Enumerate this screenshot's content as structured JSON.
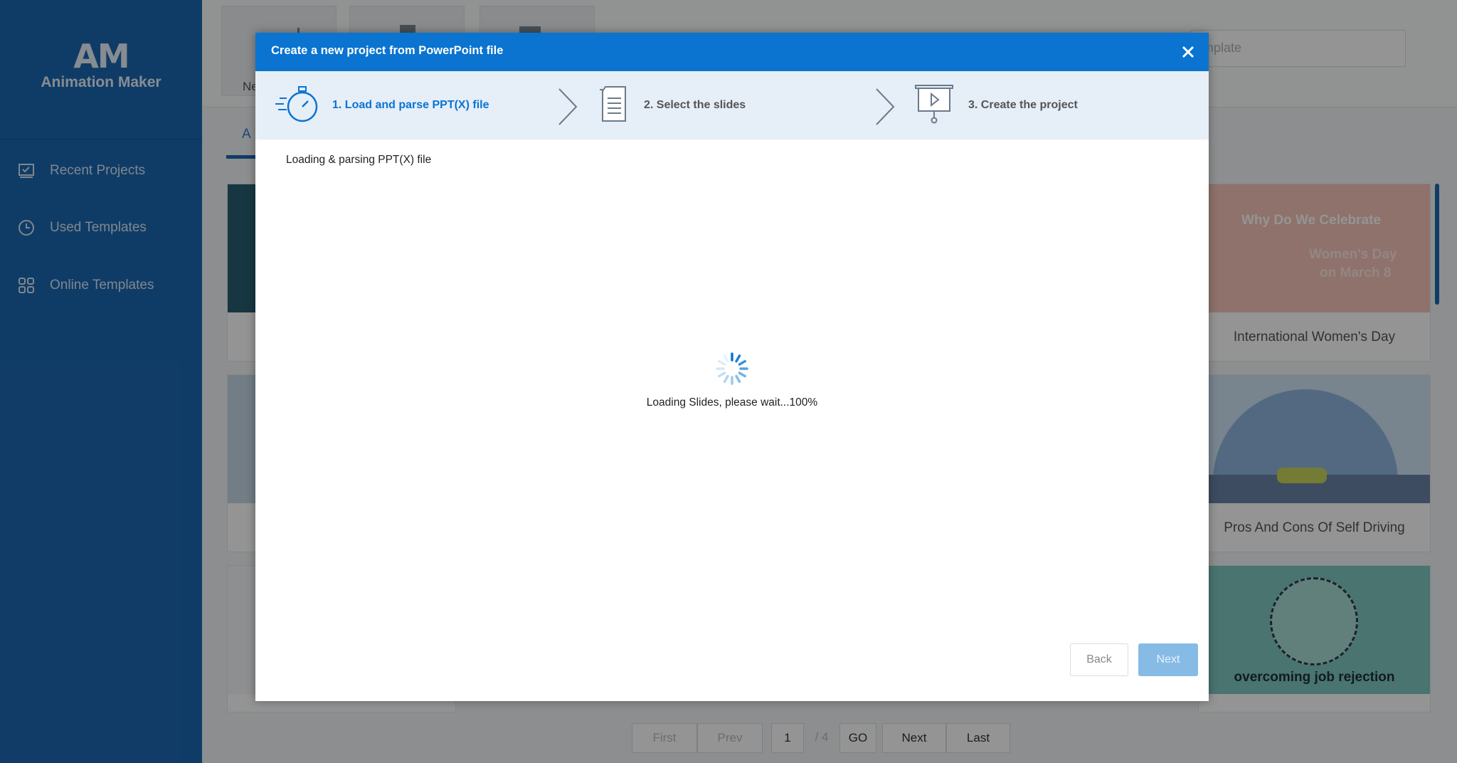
{
  "app": {
    "logo_mark": "AM",
    "name": "Animation Maker"
  },
  "sidebar": {
    "items": [
      {
        "label": "Recent Projects",
        "icon": "checklist-icon"
      },
      {
        "label": "Used Templates",
        "icon": "clock-icon"
      },
      {
        "label": "Online Templates",
        "icon": "grid-icon"
      }
    ]
  },
  "background": {
    "toolbar_partial_label": "Ne",
    "search_placeholder_partial": "mplate",
    "tab_partial": "A",
    "cards": [
      {
        "title": "International Women's Day",
        "thumb_text": [
          "Why Do We Celebrate",
          "Women's Day",
          "on March 8"
        ]
      },
      {
        "title": "Pros And Cons Of Self Driving"
      },
      {
        "title": "",
        "thumb_text": [
          "overcoming job rejection"
        ]
      }
    ],
    "pager": {
      "first": "First",
      "prev": "Prev",
      "page": "1",
      "total": "/ 4",
      "go": "GO",
      "next": "Next",
      "last": "Last"
    }
  },
  "dialog": {
    "title": "Create a new project from PowerPoint file",
    "close_icon": "close-icon",
    "steps": [
      {
        "label": "1. Load and parse PPT(X) file",
        "icon": "stopwatch-icon",
        "active": true
      },
      {
        "label": "2. Select the slides",
        "icon": "document-icon",
        "active": false
      },
      {
        "label": "3. Create the project",
        "icon": "presentation-icon",
        "active": false
      }
    ],
    "status": "Loading & parsing PPT(X) file",
    "progress_text": "Loading Slides, please wait...100%",
    "back_label": "Back",
    "next_label": "Next"
  },
  "colors": {
    "sidebar": "#1b68b1",
    "dialog_header": "#0a74d0",
    "steps_bar": "#e6eef8",
    "next_disabled": "#86bbe6"
  }
}
